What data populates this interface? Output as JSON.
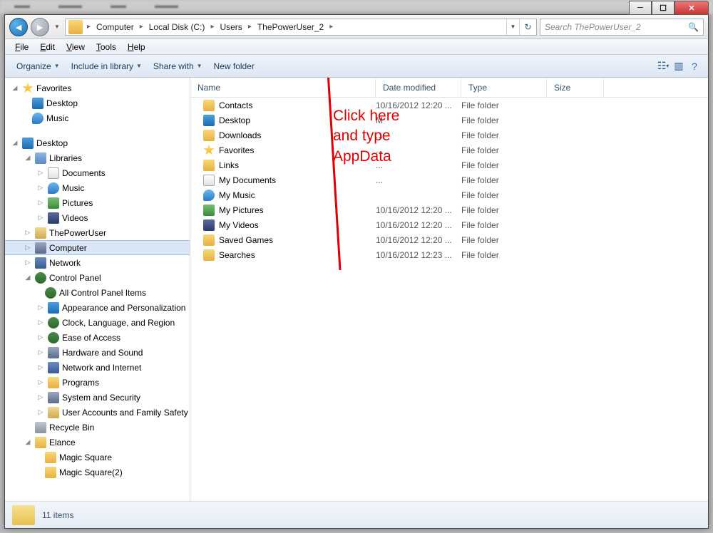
{
  "window": {
    "breadcrumb": [
      "Computer",
      "Local Disk (C:)",
      "Users",
      "ThePowerUser_2"
    ],
    "search_placeholder": "Search ThePowerUser_2"
  },
  "menubar": [
    "File",
    "Edit",
    "View",
    "Tools",
    "Help"
  ],
  "toolbar": {
    "organize": "Organize",
    "include": "Include in library",
    "share": "Share with",
    "newfolder": "New folder"
  },
  "sidebar": {
    "favorites": {
      "label": "Favorites",
      "items": [
        "Desktop",
        "Music"
      ]
    },
    "desktop": {
      "label": "Desktop",
      "children": [
        {
          "label": "Libraries",
          "children": [
            "Documents",
            "Music",
            "Pictures",
            "Videos"
          ]
        },
        {
          "label": "ThePowerUser"
        },
        {
          "label": "Computer",
          "selected": true
        },
        {
          "label": "Network"
        },
        {
          "label": "Control Panel",
          "children": [
            "All Control Panel Items",
            "Appearance and Personalization",
            "Clock, Language, and Region",
            "Ease of Access",
            "Hardware and Sound",
            "Network and Internet",
            "Programs",
            "System and Security",
            "User Accounts and Family Safety"
          ]
        },
        {
          "label": "Recycle Bin"
        },
        {
          "label": "Elance",
          "children": [
            "Magic Square",
            "Magic Square(2)"
          ]
        }
      ]
    }
  },
  "columns": {
    "name": "Name",
    "date": "Date modified",
    "type": "Type",
    "size": "Size"
  },
  "files": [
    {
      "name": "Contacts",
      "date": "10/16/2012 12:20 ...",
      "type": "File folder",
      "icon": "folder"
    },
    {
      "name": "Desktop",
      "date": "M",
      "type": "File folder",
      "icon": "desktop"
    },
    {
      "name": "Downloads",
      "date": "...",
      "type": "File folder",
      "icon": "folder"
    },
    {
      "name": "Favorites",
      "date": "...",
      "type": "File folder",
      "icon": "star"
    },
    {
      "name": "Links",
      "date": "...",
      "type": "File folder",
      "icon": "folder"
    },
    {
      "name": "My Documents",
      "date": "...",
      "type": "File folder",
      "icon": "doc"
    },
    {
      "name": "My Music",
      "date": "",
      "type": "File folder",
      "icon": "music"
    },
    {
      "name": "My Pictures",
      "date": "10/16/2012 12:20 ...",
      "type": "File folder",
      "icon": "pic"
    },
    {
      "name": "My Videos",
      "date": "10/16/2012 12:20 ...",
      "type": "File folder",
      "icon": "vid"
    },
    {
      "name": "Saved Games",
      "date": "10/16/2012 12:20 ...",
      "type": "File folder",
      "icon": "folder"
    },
    {
      "name": "Searches",
      "date": "10/16/2012 12:23 ...",
      "type": "File folder",
      "icon": "folder"
    }
  ],
  "status": {
    "count": "11 items"
  },
  "annotation": {
    "line1": "Click here",
    "line2": "and type",
    "line3": "AppData"
  }
}
